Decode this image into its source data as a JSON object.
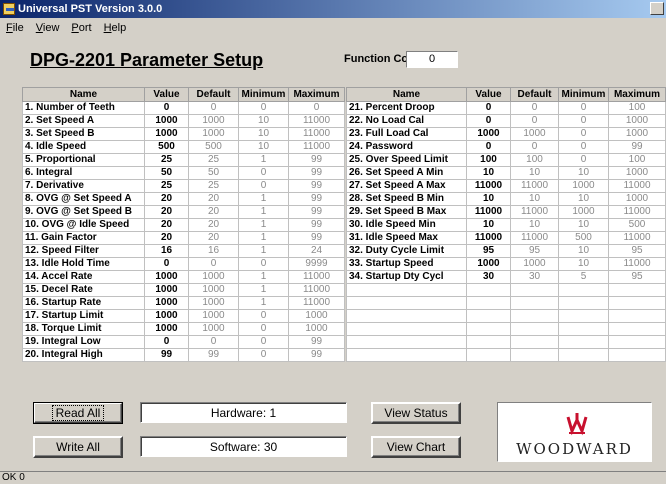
{
  "window": {
    "title": "Universal PST Version 3.0.0"
  },
  "menu": [
    {
      "label": "File",
      "u": "F",
      "rest": "ile"
    },
    {
      "label": "View",
      "u": "V",
      "rest": "iew"
    },
    {
      "label": "Port",
      "u": "P",
      "rest": "ort"
    },
    {
      "label": "Help",
      "u": "H",
      "rest": "elp"
    }
  ],
  "heading": "DPG-2201 Parameter Setup",
  "function_code": {
    "label": "Function Code",
    "value": "0"
  },
  "table": {
    "headers": [
      "Name",
      "Value",
      "Default",
      "Minimum",
      "Maximum"
    ],
    "left_rows": [
      [
        "1. Number of Teeth",
        "0",
        "0",
        "0",
        "0"
      ],
      [
        "2. Set Speed A",
        "1000",
        "1000",
        "10",
        "11000"
      ],
      [
        "3. Set Speed B",
        "1000",
        "1000",
        "10",
        "11000"
      ],
      [
        "4. Idle Speed",
        "500",
        "500",
        "10",
        "11000"
      ],
      [
        "5. Proportional",
        "25",
        "25",
        "1",
        "99"
      ],
      [
        "6. Integral",
        "50",
        "50",
        "0",
        "99"
      ],
      [
        "7. Derivative",
        "25",
        "25",
        "0",
        "99"
      ],
      [
        "8. OVG @ Set Speed A",
        "20",
        "20",
        "1",
        "99"
      ],
      [
        "9. OVG @ Set Speed B",
        "20",
        "20",
        "1",
        "99"
      ],
      [
        "10. OVG @ Idle Speed",
        "20",
        "20",
        "1",
        "99"
      ],
      [
        "11. Gain Factor",
        "20",
        "20",
        "1",
        "99"
      ],
      [
        "12. Speed Filter",
        "16",
        "16",
        "1",
        "24"
      ],
      [
        "13. Idle Hold Time",
        "0",
        "0",
        "0",
        "9999"
      ],
      [
        "14. Accel Rate",
        "1000",
        "1000",
        "1",
        "11000"
      ],
      [
        "15. Decel Rate",
        "1000",
        "1000",
        "1",
        "11000"
      ],
      [
        "16. Startup Rate",
        "1000",
        "1000",
        "1",
        "11000"
      ],
      [
        "17. Startup Limit",
        "1000",
        "1000",
        "0",
        "1000"
      ],
      [
        "18. Torque Limit",
        "1000",
        "1000",
        "0",
        "1000"
      ],
      [
        "19. Integral Low",
        "0",
        "0",
        "0",
        "99"
      ],
      [
        "20. Integral High",
        "99",
        "99",
        "0",
        "99"
      ]
    ],
    "right_rows": [
      [
        "21. Percent Droop",
        "0",
        "0",
        "0",
        "100"
      ],
      [
        "22. No Load Cal",
        "0",
        "0",
        "0",
        "1000"
      ],
      [
        "23. Full Load Cal",
        "1000",
        "1000",
        "0",
        "1000"
      ],
      [
        "24. Password",
        "0",
        "0",
        "0",
        "99"
      ],
      [
        "25. Over Speed Limit",
        "100",
        "100",
        "0",
        "100"
      ],
      [
        "26. Set Speed A Min",
        "10",
        "10",
        "10",
        "1000"
      ],
      [
        "27. Set Speed A Max",
        "11000",
        "11000",
        "1000",
        "11000"
      ],
      [
        "28. Set Speed B Min",
        "10",
        "10",
        "10",
        "1000"
      ],
      [
        "29. Set Speed B Max",
        "11000",
        "11000",
        "1000",
        "11000"
      ],
      [
        "30. Idle Speed Min",
        "10",
        "10",
        "10",
        "500"
      ],
      [
        "31. Idle Speed Max",
        "11000",
        "11000",
        "500",
        "11000"
      ],
      [
        "32. Duty Cycle Limit",
        "95",
        "95",
        "10",
        "95"
      ],
      [
        "33. Startup Speed",
        "1000",
        "1000",
        "10",
        "11000"
      ],
      [
        "34. Startup Dty Cycl",
        "30",
        "30",
        "5",
        "95"
      ],
      [
        "",
        "",
        "",
        "",
        ""
      ],
      [
        "",
        "",
        "",
        "",
        ""
      ],
      [
        "",
        "",
        "",
        "",
        ""
      ],
      [
        "",
        "",
        "",
        "",
        ""
      ],
      [
        "",
        "",
        "",
        "",
        ""
      ],
      [
        "",
        "",
        "",
        "",
        ""
      ]
    ]
  },
  "buttons": {
    "read_all": "Read All",
    "write_all": "Write All",
    "view_status": "View Status",
    "view_chart": "View Chart"
  },
  "info": {
    "hardware": "Hardware: 1",
    "software": "Software: 30"
  },
  "logo": {
    "text": "WOODWARD",
    "color": "#c8102e"
  },
  "status": "OK 0"
}
